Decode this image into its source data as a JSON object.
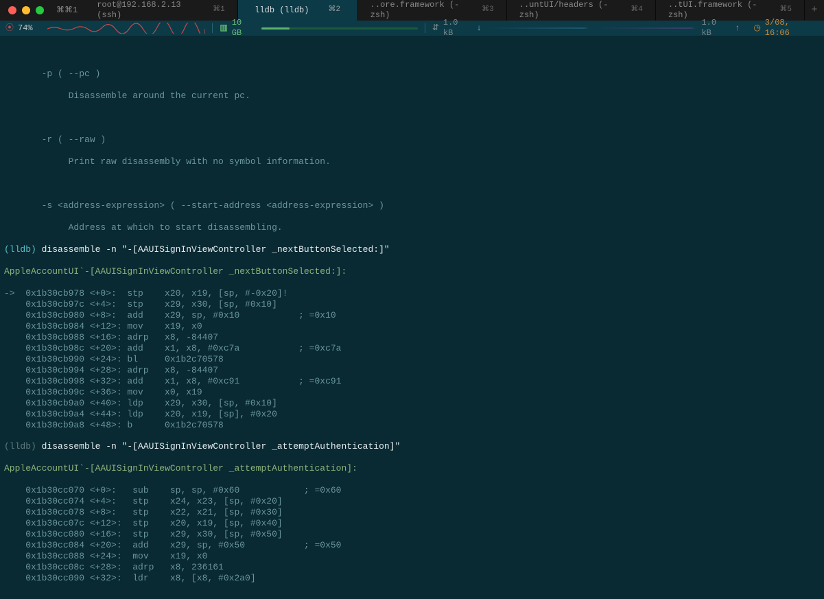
{
  "titlebar": {
    "prefix": "⌘⌘1",
    "tabs": [
      {
        "label": "root@192.168.2.13 (ssh)",
        "shortcut": "⌘1",
        "active": false
      },
      {
        "label": "lldb (lldb)",
        "shortcut": "⌘2",
        "active": true
      },
      {
        "label": "..ore.framework (-zsh)",
        "shortcut": "⌘3",
        "active": false
      },
      {
        "label": "..untUI/headers (-zsh)",
        "shortcut": "⌘4",
        "active": false
      },
      {
        "label": "..tUI.framework (-zsh)",
        "shortcut": "⌘5",
        "active": false
      }
    ]
  },
  "status": {
    "cpu_pct": "74%",
    "mem": "10 GB",
    "net_down": "1.0 kB",
    "net_up": "1.0 kB",
    "clock": "3/08, 16:06"
  },
  "help": {
    "p_flag": "-p ( --pc )",
    "p_desc": "Disassemble around the current pc.",
    "r_flag": "-r ( --raw )",
    "r_desc": "Print raw disassembly with no symbol information.",
    "s_flag": "-s <address-expression> ( --start-address <address-expression> )",
    "s_desc": "Address at which to start disassembling."
  },
  "block1": {
    "prompt": "(lldb) ",
    "cmd": "disassemble -n \"-[AAUISignInViewController _nextButtonSelected:]\"",
    "header": "AppleAccountUI`-[AAUISignInViewController _nextButtonSelected:]:",
    "rows": [
      {
        "pc": "->  ",
        "addr": "0x1b30cb978",
        "off": "<+0>: ",
        "op": "stp   ",
        "args": "x20, x19, [sp, #-0x20]!",
        "cmt": ""
      },
      {
        "pc": "    ",
        "addr": "0x1b30cb97c",
        "off": "<+4>: ",
        "op": "stp   ",
        "args": "x29, x30, [sp, #0x10]",
        "cmt": ""
      },
      {
        "pc": "    ",
        "addr": "0x1b30cb980",
        "off": "<+8>: ",
        "op": "add   ",
        "args": "x29, sp, #0x10           ",
        "cmt": "; =0x10 "
      },
      {
        "pc": "    ",
        "addr": "0x1b30cb984",
        "off": "<+12>:",
        "op": "mov   ",
        "args": "x19, x0",
        "cmt": ""
      },
      {
        "pc": "    ",
        "addr": "0x1b30cb988",
        "off": "<+16>:",
        "op": "adrp  ",
        "args": "x8, -84407",
        "cmt": ""
      },
      {
        "pc": "    ",
        "addr": "0x1b30cb98c",
        "off": "<+20>:",
        "op": "add   ",
        "args": "x1, x8, #0xc7a           ",
        "cmt": "; =0xc7a "
      },
      {
        "pc": "    ",
        "addr": "0x1b30cb990",
        "off": "<+24>:",
        "op": "bl    ",
        "args": "0x1b2c70578",
        "cmt": ""
      },
      {
        "pc": "    ",
        "addr": "0x1b30cb994",
        "off": "<+28>:",
        "op": "adrp  ",
        "args": "x8, -84407",
        "cmt": ""
      },
      {
        "pc": "    ",
        "addr": "0x1b30cb998",
        "off": "<+32>:",
        "op": "add   ",
        "args": "x1, x8, #0xc91           ",
        "cmt": "; =0xc91 "
      },
      {
        "pc": "    ",
        "addr": "0x1b30cb99c",
        "off": "<+36>:",
        "op": "mov   ",
        "args": "x0, x19",
        "cmt": ""
      },
      {
        "pc": "    ",
        "addr": "0x1b30cb9a0",
        "off": "<+40>:",
        "op": "ldp   ",
        "args": "x29, x30, [sp, #0x10]",
        "cmt": ""
      },
      {
        "pc": "    ",
        "addr": "0x1b30cb9a4",
        "off": "<+44>:",
        "op": "ldp   ",
        "args": "x20, x19, [sp], #0x20",
        "cmt": ""
      },
      {
        "pc": "    ",
        "addr": "0x1b30cb9a8",
        "off": "<+48>:",
        "op": "b     ",
        "args": "0x1b2c70578",
        "cmt": ""
      }
    ]
  },
  "block2": {
    "prompt": "(lldb) ",
    "cmd": "disassemble -n \"-[AAUISignInViewController _attemptAuthentication]\"",
    "header": "AppleAccountUI`-[AAUISignInViewController _attemptAuthentication]:",
    "rows": [
      {
        "pc": "    ",
        "addr": "0x1b30cc070",
        "off": "<+0>: ",
        "op": " sub   ",
        "args": "sp, sp, #0x60            ",
        "cmt": "; =0x60 "
      },
      {
        "pc": "    ",
        "addr": "0x1b30cc074",
        "off": "<+4>: ",
        "op": " stp   ",
        "args": "x24, x23, [sp, #0x20]",
        "cmt": ""
      },
      {
        "pc": "    ",
        "addr": "0x1b30cc078",
        "off": "<+8>: ",
        "op": " stp   ",
        "args": "x22, x21, [sp, #0x30]",
        "cmt": ""
      },
      {
        "pc": "    ",
        "addr": "0x1b30cc07c",
        "off": "<+12>:",
        "op": " stp   ",
        "args": "x20, x19, [sp, #0x40]",
        "cmt": ""
      },
      {
        "pc": "    ",
        "addr": "0x1b30cc080",
        "off": "<+16>:",
        "op": " stp   ",
        "args": "x29, x30, [sp, #0x50]",
        "cmt": ""
      },
      {
        "pc": "    ",
        "addr": "0x1b30cc084",
        "off": "<+20>:",
        "op": " add   ",
        "args": "x29, sp, #0x50           ",
        "cmt": "; =0x50 "
      },
      {
        "pc": "    ",
        "addr": "0x1b30cc088",
        "off": "<+24>:",
        "op": " mov   ",
        "args": "x19, x0",
        "cmt": ""
      },
      {
        "pc": "    ",
        "addr": "0x1b30cc08c",
        "off": "<+28>:",
        "op": " adrp  ",
        "args": "x8, 236161",
        "cmt": ""
      },
      {
        "pc": "    ",
        "addr": "0x1b30cc090",
        "off": "<+32>:",
        "op": " ldr   ",
        "args": "x8, [x8, #0x2a0]",
        "cmt": ""
      }
    ]
  }
}
